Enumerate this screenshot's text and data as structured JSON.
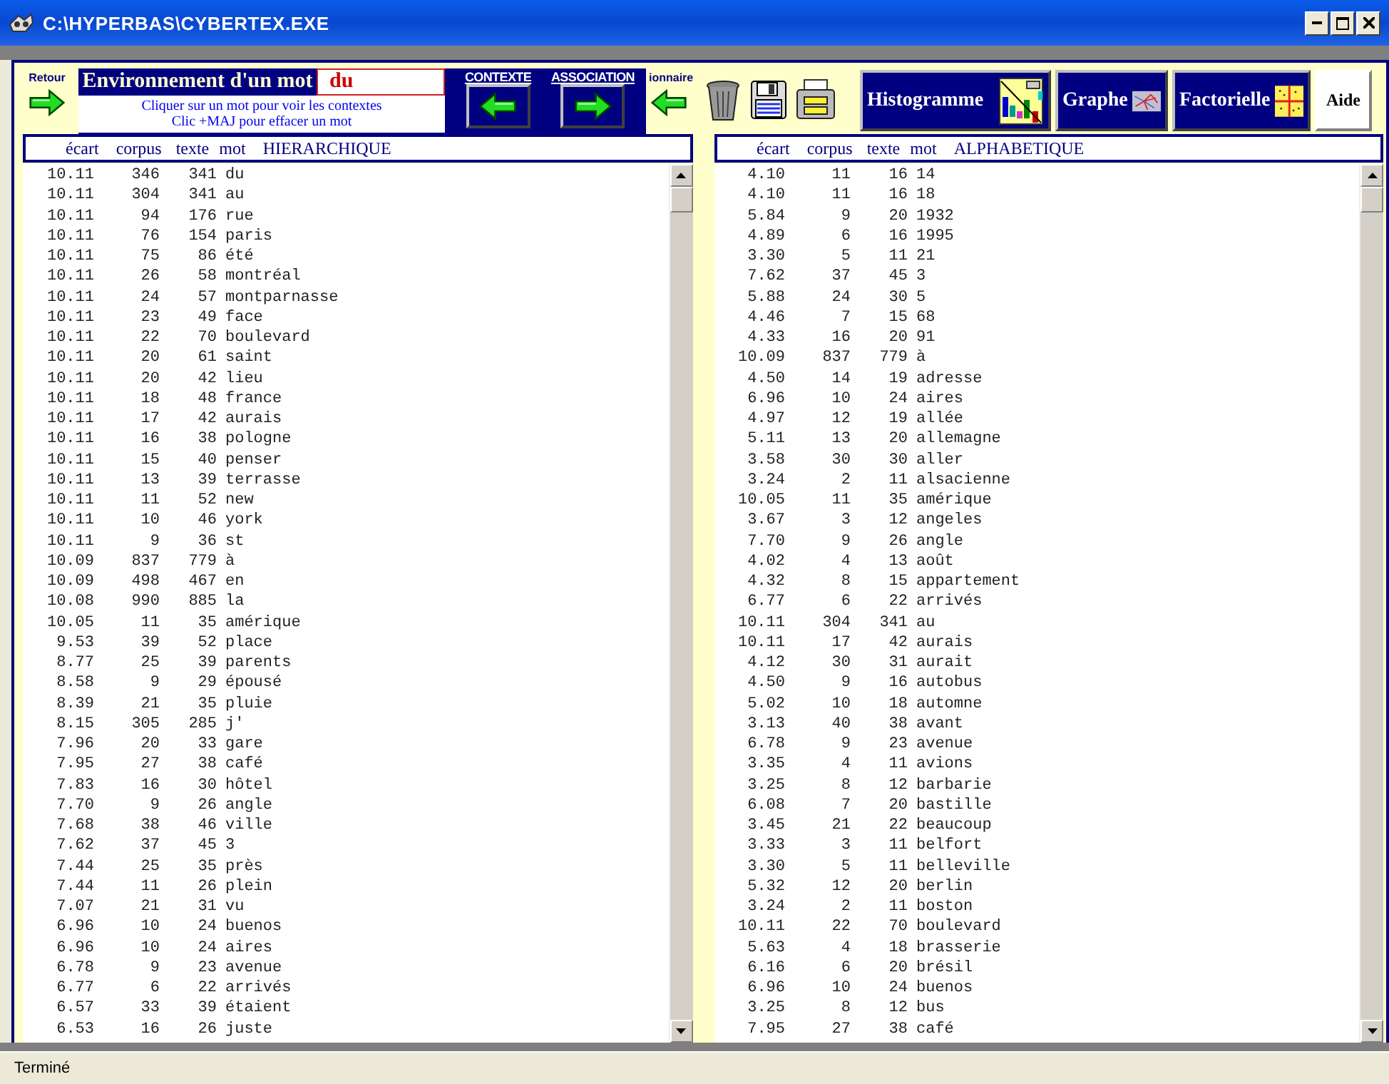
{
  "window": {
    "title": "C:\\HYPERBAS\\CYBERTEX.EXE"
  },
  "toolbar": {
    "back_label": "Retour",
    "panel_title": "Environnement d'un mot",
    "word": "du",
    "hint_lines": [
      "Cliquer sur un mot pour voir les contextes",
      "Clic +MAJ pour effacer un mot"
    ],
    "context_label": "CONTEXTE",
    "association_label": "ASSOCIATION",
    "dictionary_label": "ionnaire",
    "buttons": [
      {
        "label": "Histogramme",
        "kind": "histogram"
      },
      {
        "label": "Graphe",
        "kind": "graph"
      },
      {
        "label": "Factorielle",
        "kind": "factorial"
      },
      {
        "label": "Aide",
        "kind": "help"
      }
    ]
  },
  "lists": [
    {
      "columns": [
        "écart",
        "corpus",
        "texte",
        "mot"
      ],
      "order": "HIERARCHIQUE",
      "rows": [
        [
          "10.11",
          "346",
          "341",
          "du"
        ],
        [
          "10.11",
          "304",
          "341",
          "au"
        ],
        [
          "10.11",
          "94",
          "176",
          "rue"
        ],
        [
          "10.11",
          "76",
          "154",
          "paris"
        ],
        [
          "10.11",
          "75",
          "86",
          "été"
        ],
        [
          "10.11",
          "26",
          "58",
          "montréal"
        ],
        [
          "10.11",
          "24",
          "57",
          "montparnasse"
        ],
        [
          "10.11",
          "23",
          "49",
          "face"
        ],
        [
          "10.11",
          "22",
          "70",
          "boulevard"
        ],
        [
          "10.11",
          "20",
          "61",
          "saint"
        ],
        [
          "10.11",
          "20",
          "42",
          "lieu"
        ],
        [
          "10.11",
          "18",
          "48",
          "france"
        ],
        [
          "10.11",
          "17",
          "42",
          "aurais"
        ],
        [
          "10.11",
          "16",
          "38",
          "pologne"
        ],
        [
          "10.11",
          "15",
          "40",
          "penser"
        ],
        [
          "10.11",
          "13",
          "39",
          "terrasse"
        ],
        [
          "10.11",
          "11",
          "52",
          "new"
        ],
        [
          "10.11",
          "10",
          "46",
          "york"
        ],
        [
          "10.11",
          "9",
          "36",
          "st"
        ],
        [
          "10.09",
          "837",
          "779",
          "à"
        ],
        [
          "10.09",
          "498",
          "467",
          "en"
        ],
        [
          "10.08",
          "990",
          "885",
          "la"
        ],
        [
          "10.05",
          "11",
          "35",
          "amérique"
        ],
        [
          "9.53",
          "39",
          "52",
          "place"
        ],
        [
          "8.77",
          "25",
          "39",
          "parents"
        ],
        [
          "8.58",
          "9",
          "29",
          "épousé"
        ],
        [
          "8.39",
          "21",
          "35",
          "pluie"
        ],
        [
          "8.15",
          "305",
          "285",
          "j'"
        ],
        [
          "7.96",
          "20",
          "33",
          "gare"
        ],
        [
          "7.95",
          "27",
          "38",
          "café"
        ],
        [
          "7.83",
          "16",
          "30",
          "hôtel"
        ],
        [
          "7.70",
          "9",
          "26",
          "angle"
        ],
        [
          "7.68",
          "38",
          "46",
          "ville"
        ],
        [
          "7.62",
          "37",
          "45",
          "3"
        ],
        [
          "7.44",
          "25",
          "35",
          "près"
        ],
        [
          "7.44",
          "11",
          "26",
          "plein"
        ],
        [
          "7.07",
          "21",
          "31",
          "vu"
        ],
        [
          "6.96",
          "10",
          "24",
          "buenos"
        ],
        [
          "6.96",
          "10",
          "24",
          "aires"
        ],
        [
          "6.78",
          "9",
          "23",
          "avenue"
        ],
        [
          "6.77",
          "6",
          "22",
          "arrivés"
        ],
        [
          "6.57",
          "33",
          "39",
          "étaient"
        ],
        [
          "6.53",
          "16",
          "26",
          "juste"
        ]
      ]
    },
    {
      "columns": [
        "écart",
        "corpus",
        "texte",
        "mot"
      ],
      "order": "ALPHABETIQUE",
      "rows": [
        [
          "4.10",
          "11",
          "16",
          "14"
        ],
        [
          "4.10",
          "11",
          "16",
          "18"
        ],
        [
          "5.84",
          "9",
          "20",
          "1932"
        ],
        [
          "4.89",
          "6",
          "16",
          "1995"
        ],
        [
          "3.30",
          "5",
          "11",
          "21"
        ],
        [
          "7.62",
          "37",
          "45",
          "3"
        ],
        [
          "5.88",
          "24",
          "30",
          "5"
        ],
        [
          "4.46",
          "7",
          "15",
          "68"
        ],
        [
          "4.33",
          "16",
          "20",
          "91"
        ],
        [
          "10.09",
          "837",
          "779",
          "à"
        ],
        [
          "4.50",
          "14",
          "19",
          "adresse"
        ],
        [
          "6.96",
          "10",
          "24",
          "aires"
        ],
        [
          "4.97",
          "12",
          "19",
          "allée"
        ],
        [
          "5.11",
          "13",
          "20",
          "allemagne"
        ],
        [
          "3.58",
          "30",
          "30",
          "aller"
        ],
        [
          "3.24",
          "2",
          "11",
          "alsacienne"
        ],
        [
          "10.05",
          "11",
          "35",
          "amérique"
        ],
        [
          "3.67",
          "3",
          "12",
          "angeles"
        ],
        [
          "7.70",
          "9",
          "26",
          "angle"
        ],
        [
          "4.02",
          "4",
          "13",
          "août"
        ],
        [
          "4.32",
          "8",
          "15",
          "appartement"
        ],
        [
          "6.77",
          "6",
          "22",
          "arrivés"
        ],
        [
          "10.11",
          "304",
          "341",
          "au"
        ],
        [
          "10.11",
          "17",
          "42",
          "aurais"
        ],
        [
          "4.12",
          "30",
          "31",
          "aurait"
        ],
        [
          "4.50",
          "9",
          "16",
          "autobus"
        ],
        [
          "5.02",
          "10",
          "18",
          "automne"
        ],
        [
          "3.13",
          "40",
          "38",
          "avant"
        ],
        [
          "6.78",
          "9",
          "23",
          "avenue"
        ],
        [
          "3.35",
          "4",
          "11",
          "avions"
        ],
        [
          "3.25",
          "8",
          "12",
          "barbarie"
        ],
        [
          "6.08",
          "7",
          "20",
          "bastille"
        ],
        [
          "3.45",
          "21",
          "22",
          "beaucoup"
        ],
        [
          "3.33",
          "3",
          "11",
          "belfort"
        ],
        [
          "3.30",
          "5",
          "11",
          "belleville"
        ],
        [
          "5.32",
          "12",
          "20",
          "berlin"
        ],
        [
          "3.24",
          "2",
          "11",
          "boston"
        ],
        [
          "10.11",
          "22",
          "70",
          "boulevard"
        ],
        [
          "5.63",
          "4",
          "18",
          "brasserie"
        ],
        [
          "6.16",
          "6",
          "20",
          "brésil"
        ],
        [
          "6.96",
          "10",
          "24",
          "buenos"
        ],
        [
          "3.25",
          "8",
          "12",
          "bus"
        ],
        [
          "7.95",
          "27",
          "38",
          "café"
        ]
      ]
    }
  ],
  "status_bar": "Terminé"
}
